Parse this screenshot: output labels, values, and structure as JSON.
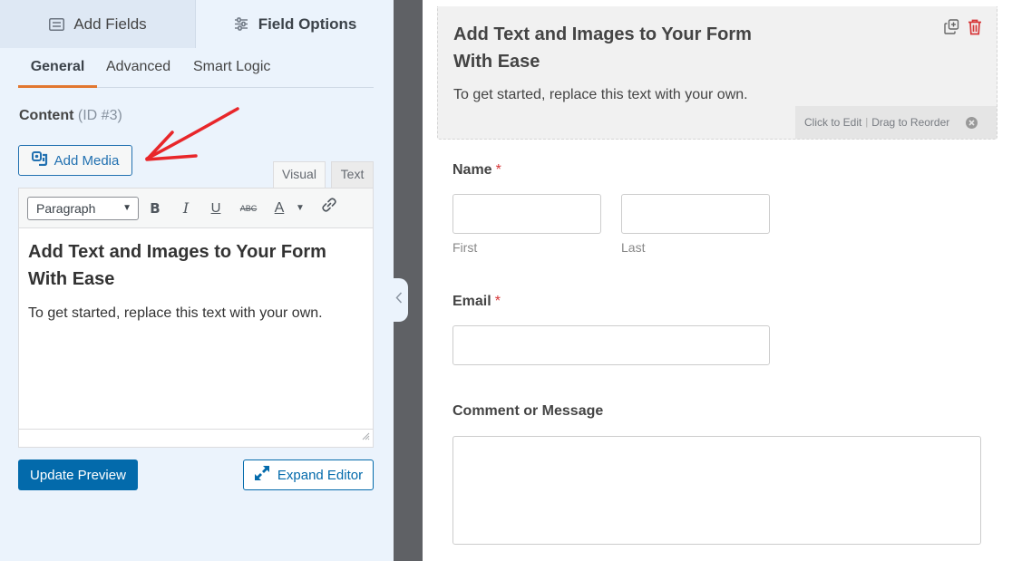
{
  "left_panel": {
    "tabs": [
      {
        "label": "Add Fields",
        "icon": "list-icon"
      },
      {
        "label": "Field Options",
        "icon": "sliders-icon"
      }
    ],
    "sub_tabs": [
      {
        "label": "General",
        "active": true
      },
      {
        "label": "Advanced",
        "active": false
      },
      {
        "label": "Smart Logic",
        "active": false
      }
    ],
    "content_label": "Content",
    "content_id": "(ID #3)",
    "add_media_label": "Add Media",
    "editor_tabs": {
      "visual": "Visual",
      "text": "Text"
    },
    "toolbar": {
      "format_value": "Paragraph",
      "bold": "B",
      "italic": "I",
      "underline": "U",
      "strike": "ABC",
      "text_color": "A"
    },
    "editor": {
      "heading": "Add Text and Images to Your Form With Ease",
      "paragraph": "To get started, replace this text with your own."
    },
    "update_preview_label": "Update Preview",
    "expand_editor_label": "Expand Editor"
  },
  "preview": {
    "content_block": {
      "title": "Add Text and Images to Your Form With Ease",
      "text": "To get started, replace this text with your own.",
      "click_to_edit": "Click to Edit",
      "separator": "|",
      "drag_to_reorder": "Drag to Reorder"
    },
    "fields": {
      "name": {
        "label": "Name",
        "required": "*",
        "first": "First",
        "last": "Last"
      },
      "email": {
        "label": "Email",
        "required": "*"
      },
      "comment": {
        "label": "Comment or Message"
      }
    }
  },
  "colors": {
    "panel_bg": "#ebf3fc",
    "accent_orange": "#e27730",
    "primary_blue": "#036aab",
    "required_red": "#d63638",
    "divider": "#5f6165",
    "annotation_arrow": "#e8262a"
  }
}
